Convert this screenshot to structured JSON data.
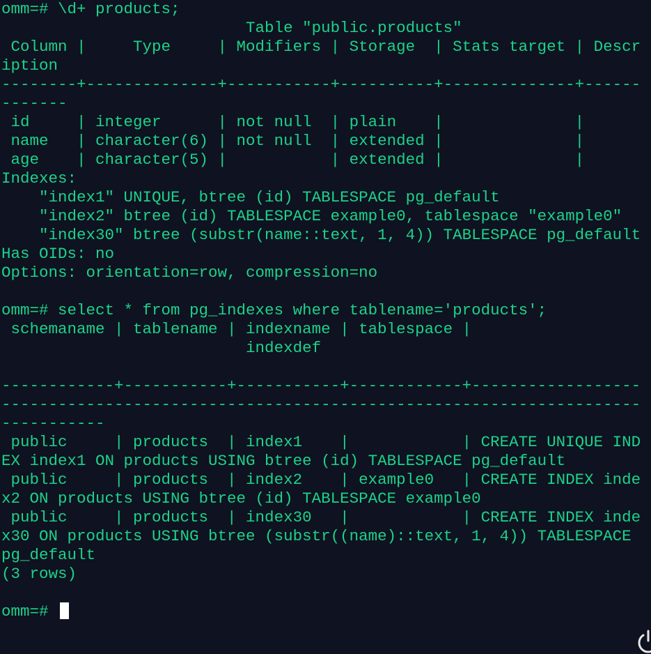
{
  "terminal": {
    "prompt": "omm=#",
    "lines": [
      "omm=# \\d+ products;",
      "                          Table \"public.products\"",
      " Column |     Type     | Modifiers | Storage  | Stats target | Descr",
      "iption",
      "--------+--------------+-----------+----------+--------------+------",
      "-------",
      " id     | integer      | not null  | plain    |              |",
      " name   | character(6) | not null  | extended |              |",
      " age    | character(5) |           | extended |              |",
      "Indexes:",
      "    \"index1\" UNIQUE, btree (id) TABLESPACE pg_default",
      "    \"index2\" btree (id) TABLESPACE example0, tablespace \"example0\"",
      "    \"index30\" btree (substr(name::text, 1, 4)) TABLESPACE pg_default",
      "Has OIDs: no",
      "Options: orientation=row, compression=no",
      "",
      "omm=# select * from pg_indexes where tablename='products';",
      " schemaname | tablename | indexname | tablespace |",
      "                          indexdef",
      "",
      "------------+-----------+-----------+------------+------------------",
      "--------------------------------------------------------------------",
      "-----------",
      " public     | products  | index1    |            | CREATE UNIQUE IND",
      "EX index1 ON products USING btree (id) TABLESPACE pg_default",
      " public     | products  | index2    | example0   | CREATE INDEX inde",
      "x2 ON products USING btree (id) TABLESPACE example0",
      " public     | products  | index30   |            | CREATE INDEX inde",
      "x30 ON products USING btree (substr((name)::text, 1, 4)) TABLESPACE",
      "pg_default",
      "(3 rows)",
      ""
    ]
  },
  "icons": {
    "power": "power-icon"
  },
  "colors": {
    "background": "#0f1220",
    "text": "#1cd28a",
    "cursor": "#ffffff"
  }
}
